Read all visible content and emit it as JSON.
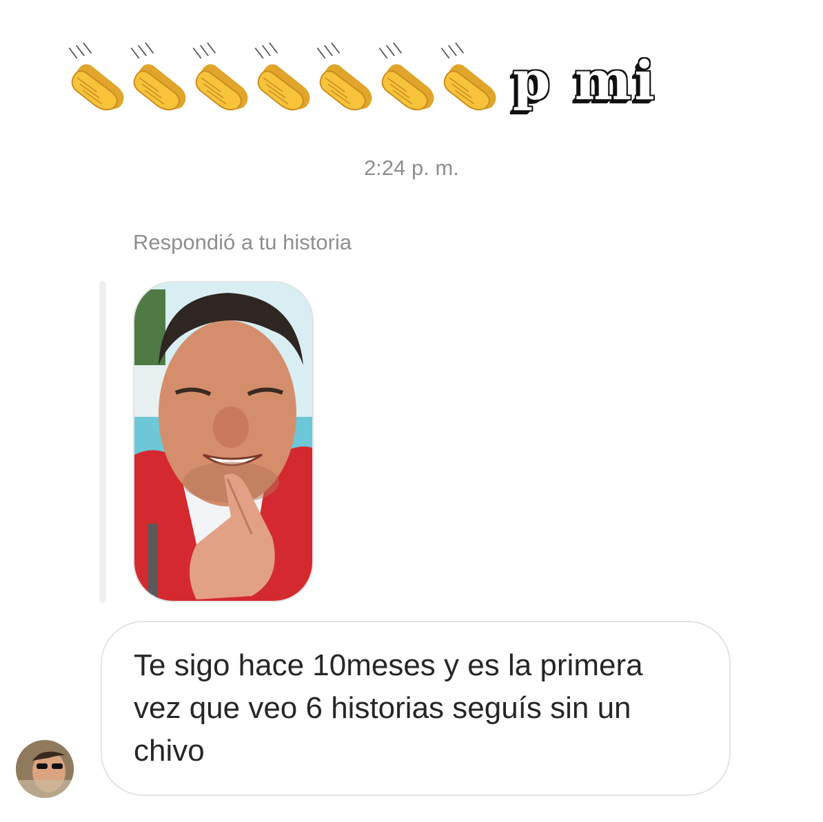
{
  "sticker": {
    "clap_count": 7,
    "clap_icon": "clapping-hands-icon",
    "text": "p mi"
  },
  "thread": {
    "timestamp": "2:24 p. m.",
    "reply_label": "Respondió a tu historia",
    "message": "Te sigo hace 10meses y es la primera\nvez que veo 6 historias seguís sin un\nchivo"
  },
  "colors": {
    "meta_text": "#8e8e8e",
    "message_text": "#262626",
    "bubble_border": "#e3e3e3",
    "clap_yellow": "#f6c33b"
  }
}
